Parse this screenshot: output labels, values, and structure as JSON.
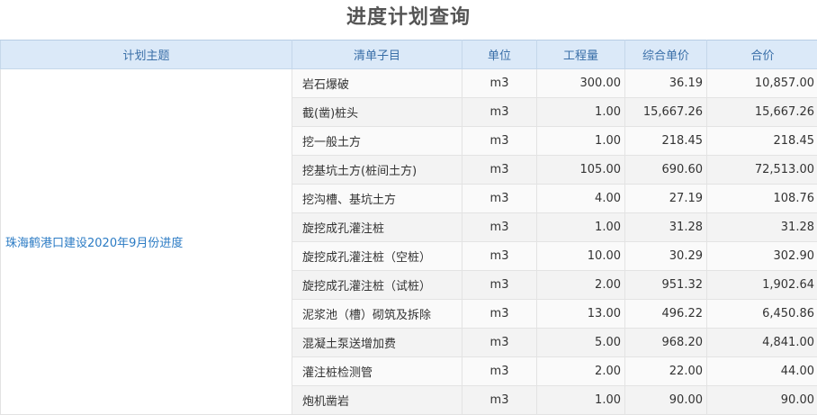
{
  "page_title": "进度计划查询",
  "columns": {
    "plan": "计划主题",
    "item": "清单子目",
    "unit": "单位",
    "quantity": "工程量",
    "unit_price": "综合单价",
    "total": "合价"
  },
  "plan_name": "珠海鹤港口建设2020年9月份进度",
  "rows": [
    {
      "item": "岩石爆破",
      "unit": "m3",
      "quantity": "300.00",
      "unit_price": "36.19",
      "total": "10,857.00"
    },
    {
      "item": "截(凿)桩头",
      "unit": "m3",
      "quantity": "1.00",
      "unit_price": "15,667.26",
      "total": "15,667.26"
    },
    {
      "item": "挖一般土方",
      "unit": "m3",
      "quantity": "1.00",
      "unit_price": "218.45",
      "total": "218.45"
    },
    {
      "item": "挖基坑土方(桩间土方)",
      "unit": "m3",
      "quantity": "105.00",
      "unit_price": "690.60",
      "total": "72,513.00"
    },
    {
      "item": "挖沟槽、基坑土方",
      "unit": "m3",
      "quantity": "4.00",
      "unit_price": "27.19",
      "total": "108.76"
    },
    {
      "item": "旋挖成孔灌注桩",
      "unit": "m3",
      "quantity": "1.00",
      "unit_price": "31.28",
      "total": "31.28"
    },
    {
      "item": "旋挖成孔灌注桩（空桩）",
      "unit": "m3",
      "quantity": "10.00",
      "unit_price": "30.29",
      "total": "302.90"
    },
    {
      "item": "旋挖成孔灌注桩（试桩）",
      "unit": "m3",
      "quantity": "2.00",
      "unit_price": "951.32",
      "total": "1,902.64"
    },
    {
      "item": "泥浆池（槽）砌筑及拆除",
      "unit": "m3",
      "quantity": "13.00",
      "unit_price": "496.22",
      "total": "6,450.86"
    },
    {
      "item": "混凝土泵送增加费",
      "unit": "m3",
      "quantity": "5.00",
      "unit_price": "968.20",
      "total": "4,841.00"
    },
    {
      "item": "灌注桩检测管",
      "unit": "m3",
      "quantity": "2.00",
      "unit_price": "22.00",
      "total": "44.00"
    },
    {
      "item": "炮机凿岩",
      "unit": "m3",
      "quantity": "1.00",
      "unit_price": "90.00",
      "total": "90.00"
    }
  ]
}
